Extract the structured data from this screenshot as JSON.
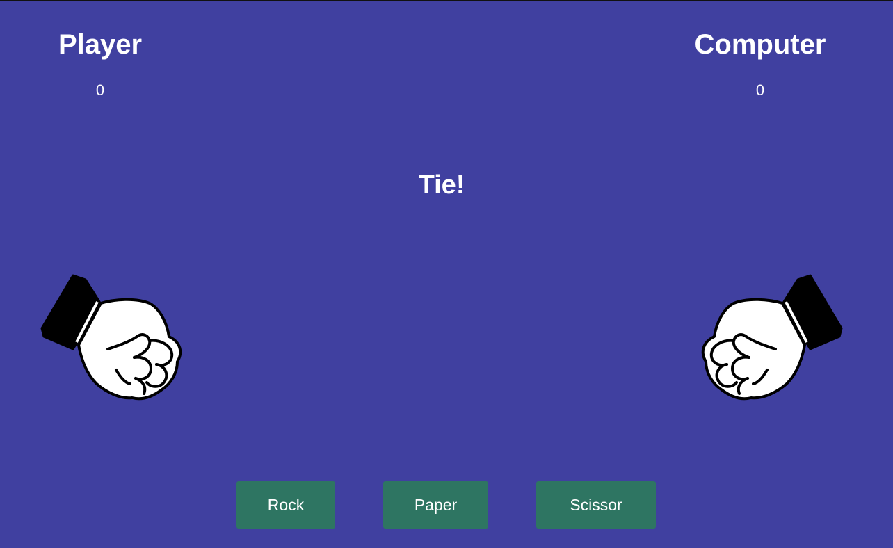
{
  "player": {
    "title": "Player",
    "score": "0",
    "hand_icon": "rock-fist-icon"
  },
  "computer": {
    "title": "Computer",
    "score": "0",
    "hand_icon": "rock-fist-icon"
  },
  "result": "Tie!",
  "choices": {
    "rock": "Rock",
    "paper": "Paper",
    "scissor": "Scissor"
  },
  "colors": {
    "background": "#4040a0",
    "button": "#2e7562",
    "text": "#ffffff"
  }
}
